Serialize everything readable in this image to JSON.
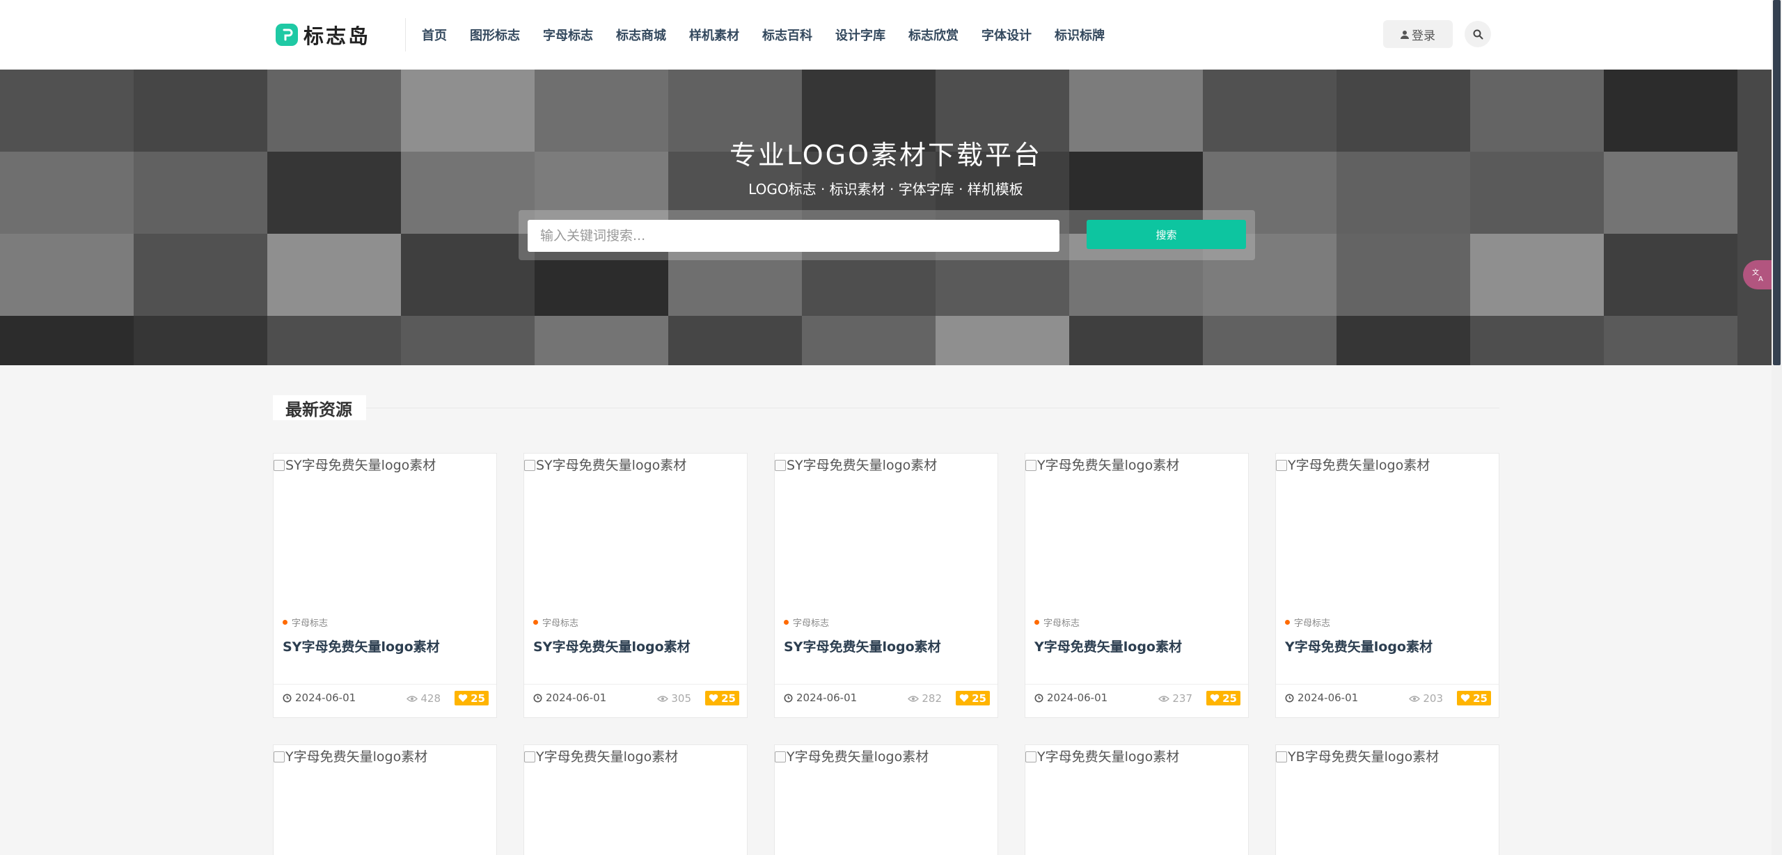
{
  "brand": {
    "name": "标志岛",
    "accent": "#1fc9a4"
  },
  "nav": [
    "首页",
    "图形标志",
    "字母标志",
    "标志商城",
    "样机素材",
    "标志百科",
    "设计字库",
    "标志欣赏",
    "字体设计",
    "标识标牌"
  ],
  "header": {
    "login_label": "登录",
    "search_icon": "search-icon"
  },
  "hero": {
    "title": "专业LOGO素材下载平台",
    "subtitle": "LOGO标志 · 标识素材 · 字体字库 · 样机模板",
    "search_placeholder": "输入关键词搜索...",
    "search_button": "搜索",
    "button_color": "#0dc5a0"
  },
  "section": {
    "title": "最新资源"
  },
  "cards": [
    {
      "alt": "SY字母免费矢量logo素材",
      "category": "字母标志",
      "title_prefix": "SY",
      "title_rest": "字母免费矢量logo素材",
      "date": "2024-06-01",
      "views": "428",
      "likes": "25"
    },
    {
      "alt": "SY字母免费矢量logo素材",
      "category": "字母标志",
      "title_prefix": "SY",
      "title_rest": "字母免费矢量logo素材",
      "date": "2024-06-01",
      "views": "305",
      "likes": "25"
    },
    {
      "alt": "SY字母免费矢量logo素材",
      "category": "字母标志",
      "title_prefix": "SY",
      "title_rest": "字母免费矢量logo素材",
      "date": "2024-06-01",
      "views": "282",
      "likes": "25"
    },
    {
      "alt": "Y字母免费矢量logo素材",
      "category": "字母标志",
      "title_prefix": "Y",
      "title_rest": "字母免费矢量logo素材",
      "date": "2024-06-01",
      "views": "237",
      "likes": "25"
    },
    {
      "alt": "Y字母免费矢量logo素材",
      "category": "字母标志",
      "title_prefix": "Y",
      "title_rest": "字母免费矢量logo素材",
      "date": "2024-06-01",
      "views": "203",
      "likes": "25"
    }
  ],
  "cards_row2": [
    {
      "alt": "Y字母免费矢量logo素材"
    },
    {
      "alt": "Y字母免费矢量logo素材"
    },
    {
      "alt": "Y字母免费矢量logo素材"
    },
    {
      "alt": "Y字母免费矢量logo素材"
    },
    {
      "alt": "YB字母免费矢量logo素材"
    }
  ],
  "colors": {
    "like_badge": "#ffb400",
    "category_dot": "#ff6a00",
    "translate_fab": "#b2557f"
  }
}
